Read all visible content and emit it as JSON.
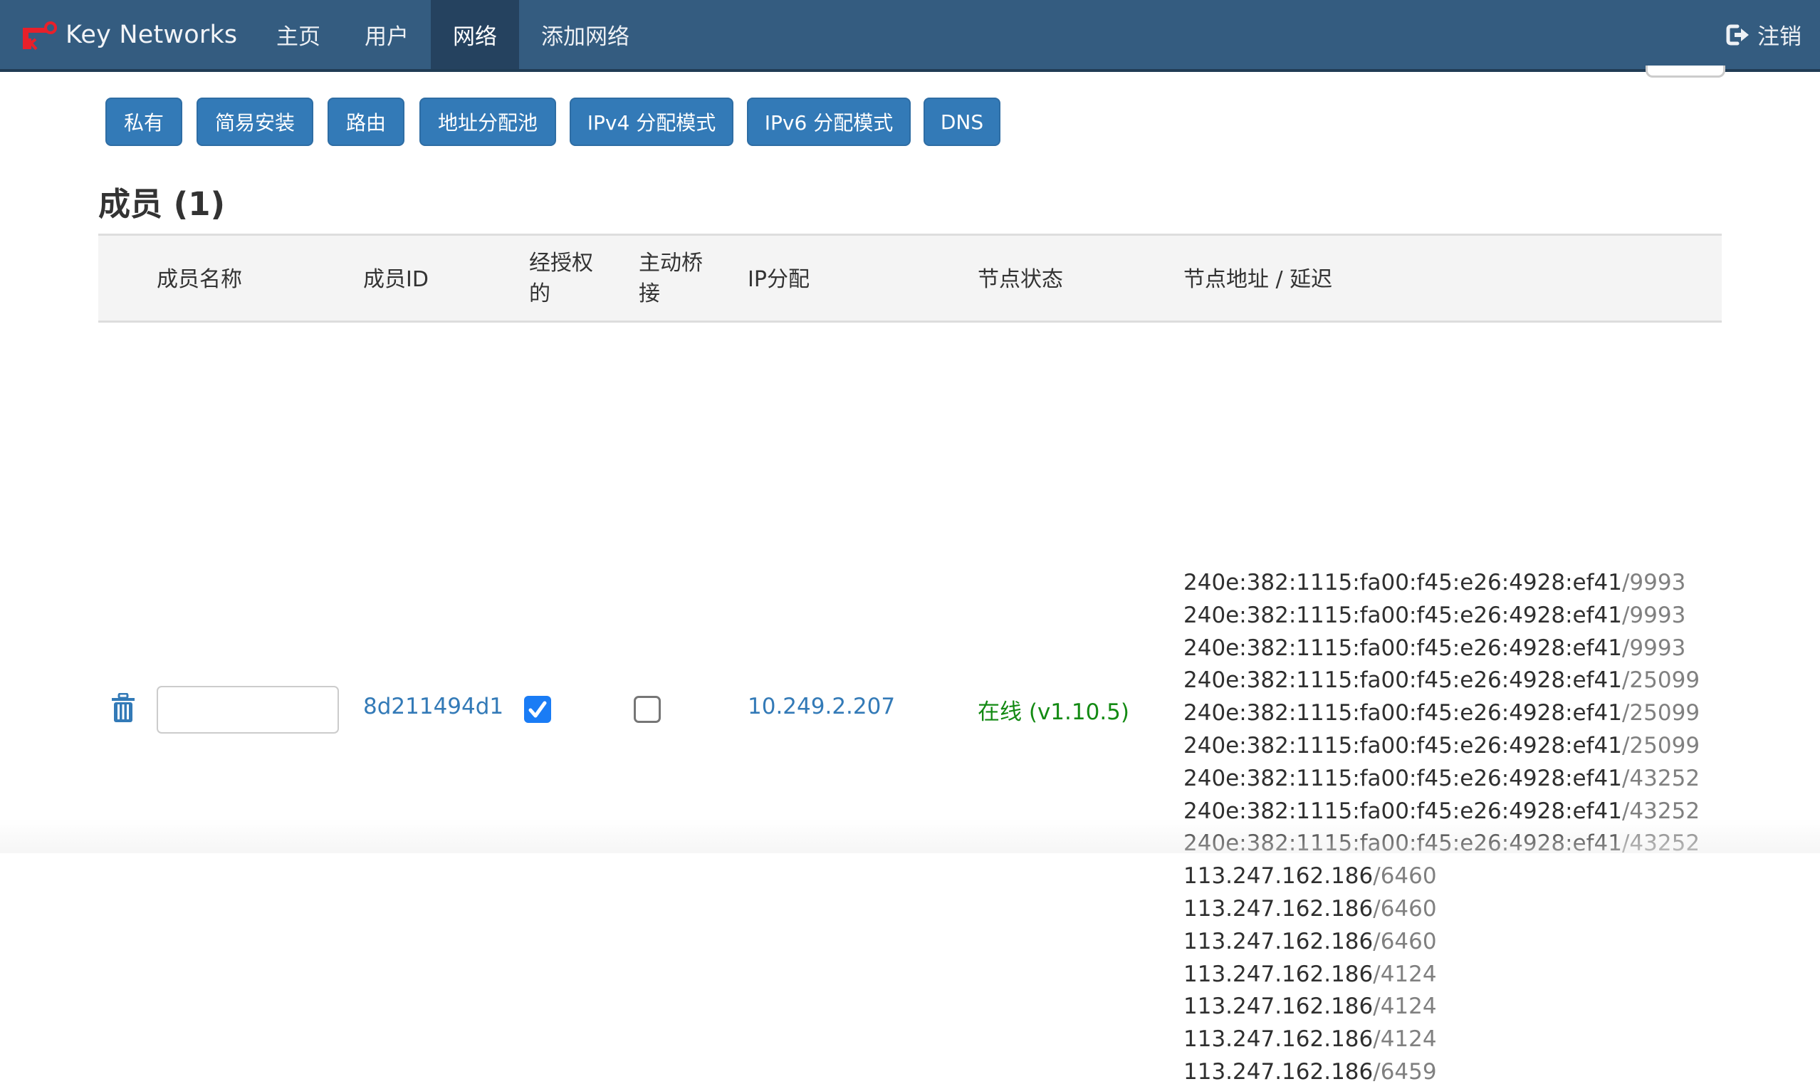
{
  "navbar": {
    "brand": "Key Networks",
    "items": [
      {
        "label": "主页",
        "active": false
      },
      {
        "label": "用户",
        "active": false
      },
      {
        "label": "网络",
        "active": true
      },
      {
        "label": "添加网络",
        "active": false
      }
    ],
    "logout_label": "注销",
    "colors": {
      "background": "#345c80",
      "active": "#25425f",
      "logo": "#e8202a"
    }
  },
  "toolbar": {
    "buttons": [
      {
        "label": "私有"
      },
      {
        "label": "简易安装"
      },
      {
        "label": "路由"
      },
      {
        "label": "地址分配池"
      },
      {
        "label": "IPv4 分配模式"
      },
      {
        "label": "IPv6 分配模式"
      },
      {
        "label": "DNS"
      }
    ],
    "button_color": "#337ab7"
  },
  "members": {
    "title": "成员 (1)",
    "columns": [
      {
        "key": "name",
        "label": "成员名称"
      },
      {
        "key": "id",
        "label": "成员ID"
      },
      {
        "key": "authorized",
        "label_line1": "经授权",
        "label_line2": "的"
      },
      {
        "key": "bridge",
        "label_line1": "主动桥",
        "label_line2": "接"
      },
      {
        "key": "ip",
        "label": "IP分配"
      },
      {
        "key": "status",
        "label": "节点状态"
      },
      {
        "key": "addresses",
        "label": "节点地址 / 延迟"
      }
    ],
    "rows": [
      {
        "name_value": "",
        "name_placeholder": "",
        "id": "8d211494d1",
        "authorized": true,
        "active_bridge": false,
        "ip": "10.249.2.207",
        "status": "在线 (v1.10.5)",
        "status_color": "#138a13",
        "addresses": [
          {
            "host": "240e:382:1115:fa00:f45:e26:4928:ef41",
            "latency": "/9993"
          },
          {
            "host": "240e:382:1115:fa00:f45:e26:4928:ef41",
            "latency": "/9993"
          },
          {
            "host": "240e:382:1115:fa00:f45:e26:4928:ef41",
            "latency": "/9993"
          },
          {
            "host": "240e:382:1115:fa00:f45:e26:4928:ef41",
            "latency": "/25099"
          },
          {
            "host": "240e:382:1115:fa00:f45:e26:4928:ef41",
            "latency": "/25099"
          },
          {
            "host": "240e:382:1115:fa00:f45:e26:4928:ef41",
            "latency": "/25099"
          },
          {
            "host": "240e:382:1115:fa00:f45:e26:4928:ef41",
            "latency": "/43252"
          },
          {
            "host": "240e:382:1115:fa00:f45:e26:4928:ef41",
            "latency": "/43252"
          },
          {
            "host": "240e:382:1115:fa00:f45:e26:4928:ef41",
            "latency": "/43252"
          },
          {
            "host": "113.247.162.186",
            "latency": "/6460"
          },
          {
            "host": "113.247.162.186",
            "latency": "/6460"
          },
          {
            "host": "113.247.162.186",
            "latency": "/6460"
          },
          {
            "host": "113.247.162.186",
            "latency": "/4124"
          },
          {
            "host": "113.247.162.186",
            "latency": "/4124"
          },
          {
            "host": "113.247.162.186",
            "latency": "/4124"
          },
          {
            "host": "113.247.162.186",
            "latency": "/6459"
          }
        ]
      }
    ]
  },
  "icons": {
    "logo": "key-logo-icon",
    "logout": "sign-out-icon",
    "delete": "trash-icon",
    "checked": "checkbox-checked-icon",
    "unchecked": "checkbox-unchecked-icon"
  }
}
